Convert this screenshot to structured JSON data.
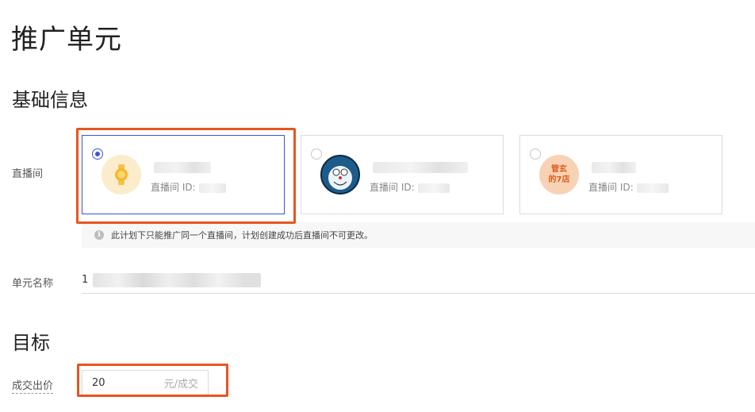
{
  "page": {
    "title": "推广单元"
  },
  "sections": {
    "basic": "基础信息",
    "goal": "目标"
  },
  "labels": {
    "room": "直播间",
    "unit_name": "单元名称",
    "bid": "成交出价"
  },
  "rooms": [
    {
      "name_prefix": "",
      "id_label": "直播间 ID:",
      "selected": true,
      "avatar": "watch-icon"
    },
    {
      "name_prefix": "",
      "id_label": "直播间 ID:",
      "selected": false,
      "avatar": "cartoon-avatar"
    },
    {
      "name_prefix": "",
      "id_label": "直播间 ID:",
      "selected": false,
      "avatar_text": "管玄\n的7店"
    }
  ],
  "notice": {
    "icon": "info-icon",
    "text": "此计划下只能推广同一个直播间，计划创建成功后直播间不可更改。"
  },
  "unit_name": {
    "value_prefix": "1"
  },
  "bid": {
    "value": "20",
    "unit": "元/成交"
  },
  "colors": {
    "accent": "#3a55d6",
    "highlight": "#e8551f"
  }
}
